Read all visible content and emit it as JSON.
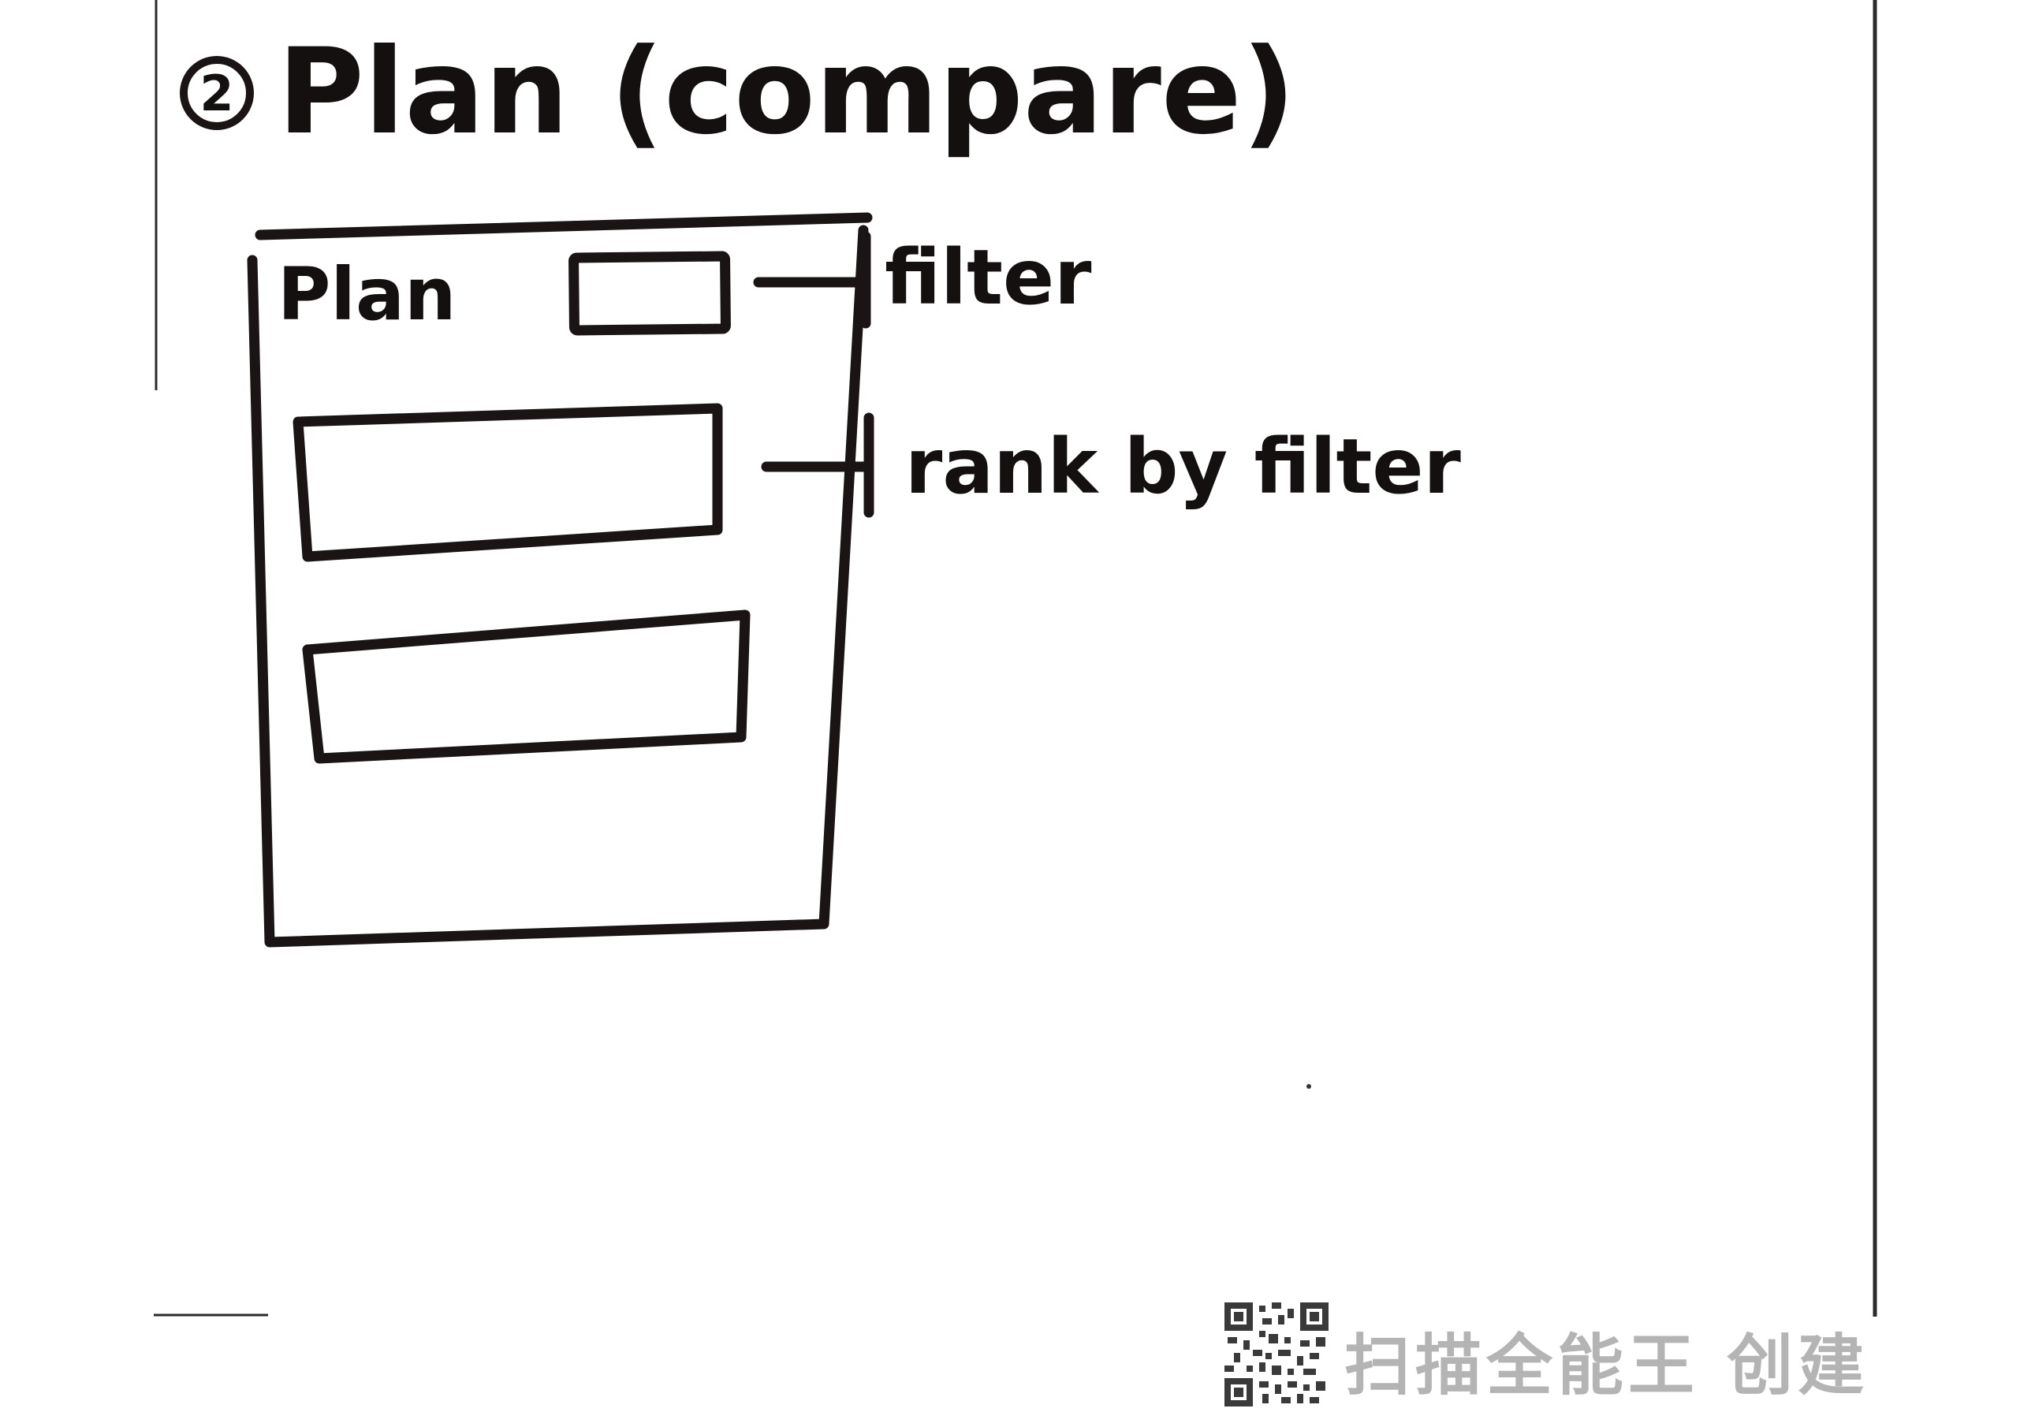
{
  "title": {
    "step_number": "2",
    "text": "Plan (compare)"
  },
  "panel": {
    "header_label": "Plan"
  },
  "annotations": {
    "filter_label": "filter",
    "rank_label": "rank by filter"
  },
  "watermark": {
    "text": "扫描全能王 创建"
  },
  "colors": {
    "ink": "#1a1514",
    "watermark": "#b4b4b4",
    "paper": "#ffffff"
  }
}
